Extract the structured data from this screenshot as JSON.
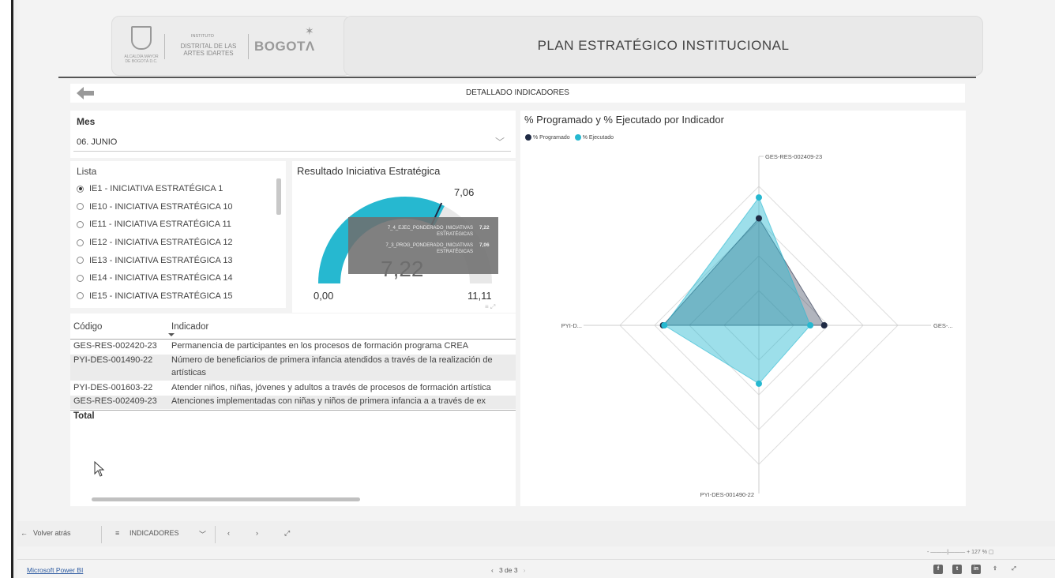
{
  "header": {
    "logo_small_text": "INSTITUTO",
    "logo_institute": "DISTRITAL DE LAS ARTES IDARTES",
    "logo_city": "BOGOTΛ",
    "logo_subtext": "ALCALDÍA MAYOR DE BOGOTÁ D.C.",
    "title": "PLAN ESTRATÉGICO INSTITUCIONAL"
  },
  "subheader": {
    "title": "DETALLADO INDICADORES"
  },
  "mes": {
    "label": "Mes",
    "value": "06. JUNIO"
  },
  "lista": {
    "label": "Lista",
    "items": [
      {
        "label": "IE1 - INICIATIVA ESTRATÉGICA 1",
        "selected": true
      },
      {
        "label": "IE10 - INICIATIVA ESTRATÉGICA 10",
        "selected": false
      },
      {
        "label": "IE11 - INICIATIVA ESTRATÉGICA 11",
        "selected": false
      },
      {
        "label": "IE12 - INICIATIVA ESTRATÉGICA 12",
        "selected": false
      },
      {
        "label": "IE13 - INICIATIVA ESTRATÉGICA 13",
        "selected": false
      },
      {
        "label": "IE14 - INICIATIVA ESTRATÉGICA 14",
        "selected": false
      },
      {
        "label": "IE15 - INICIATIVA ESTRATÉGICA 15",
        "selected": false
      }
    ]
  },
  "gauge": {
    "title": "Resultado Iniciativa Estratégica",
    "value": "7,22",
    "target": "7,06",
    "min": "0,00",
    "max": "11,11",
    "tooltip": [
      {
        "label": "7_4_EJEC_PONDERADO_INICIATIVAS ESTRATÉGICAS",
        "value": "7,22"
      },
      {
        "label": "7_3_PROG_PONDERADO_INICIATIVAS ESTRATÉGICAS",
        "value": "7,06"
      }
    ],
    "accent": "#26b8d0"
  },
  "table": {
    "headers": [
      "Código",
      "Indicador"
    ],
    "rows": [
      {
        "code": "GES-RES-002420-23",
        "indicator": "Permanencia de participantes en los procesos de formación programa CREA"
      },
      {
        "code": "PYI-DES-001490-22",
        "indicator": "Número de beneficiarios de primera infancia atendidos a través de la realización de",
        "indicator2": "artísticas"
      },
      {
        "code": "PYI-DES-001603-22",
        "indicator": "Atender niños, niñas, jóvenes y adultos a través de procesos de formación artística"
      },
      {
        "code": "GES-RES-002409-23",
        "indicator": "Atenciones implementadas con niñas y niños de primera infancia a a través de ex"
      }
    ],
    "total_label": "Total"
  },
  "chart_data": {
    "type": "radar",
    "title": "% Programado y % Ejecutado por Indicador",
    "axes": [
      "GES-RES-002409-23",
      "GES-...",
      "PYI-DES-001490-22",
      "PYI-D..."
    ],
    "series": [
      {
        "name": "% Programado",
        "color": "#1f2a44",
        "values": [
          0.77,
          0.47,
          0.0,
          0.69
        ]
      },
      {
        "name": "% Ejecutado",
        "color": "#26b8d0",
        "values": [
          0.92,
          0.37,
          0.42,
          0.68
        ]
      }
    ],
    "rings": 4,
    "legend_position": "top-left"
  },
  "nav": {
    "back": "Volver atrás",
    "page": "INDICADORES",
    "prev": "‹",
    "next": "›"
  },
  "zoom": {
    "value": "127 %"
  },
  "footer": {
    "link": "Microsoft Power BI",
    "pages": "3 de 3"
  }
}
